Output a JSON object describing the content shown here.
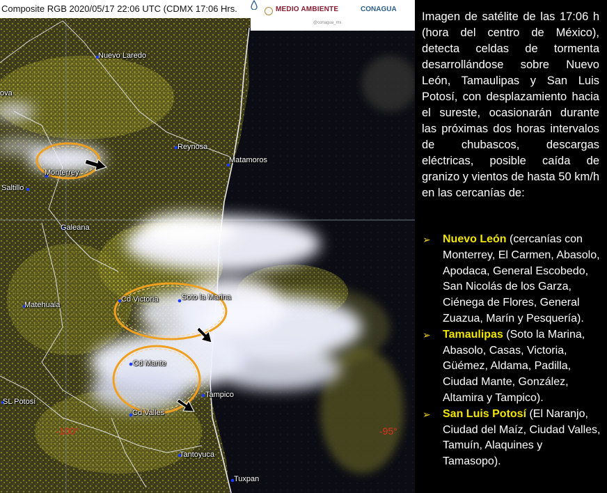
{
  "header": {
    "title": "Composite RGB 2020/05/17 22:06 UTC (CDMX  17:06 Hrs.",
    "logo_left": "MEDIO AMBIENTE",
    "logo_right": "CONAGUA",
    "logo_sub": "@conagua_mx"
  },
  "map": {
    "cities": [
      "Nuevo Laredo",
      "Reynosa",
      "Matamoros",
      "Monterrey",
      "Saltillo",
      "Galeana",
      "Cd Victoria",
      "Soto la Marina",
      "Matehuala",
      "Cd Mante",
      "Tampico",
      "SL Potosí",
      "Cd Valles",
      "Tantoyuca",
      "Tuxpan",
      "ova"
    ],
    "lon_left": "-100°",
    "lon_right": "-95°"
  },
  "panel": {
    "intro": "Imagen de satélite de las 17:06 h (hora del centro de México), detecta celdas de tormenta desarrollándose sobre Nuevo León, Tamaulipas y San Luis Potosí, con desplazamiento hacia el sureste, ocasionarán durante las próximas dos horas intervalos de chubascos, descargas eléctricas, posible caída de granizo y vientos de hasta 50 km/h en las cercanías de:",
    "bullet": "➢",
    "states": [
      {
        "name": "Nuevo León",
        "places": " (cercanías con Monterrey, El Carmen, Abasolo, Apodaca, General Escobedo, San Nicolás de los Garza, Ciénega de Flores, General Zuazua, Marín y Pesquería)."
      },
      {
        "name": "Tamaulipas",
        "places": " (Soto la Marina, Abasolo, Casas, Victoria, Güémez, Aldama, Padilla, Ciudad Mante, González, Altamira y Tampico)."
      },
      {
        "name": "San Luis Potosí",
        "places": " (El Naranjo, Ciudad del Maíz, Ciudad Valles, Tamuín, Alaquines y Tamasopo)."
      }
    ]
  },
  "colors": {
    "state_name": "#f2e600",
    "bullet": "#f2d21a",
    "ellipse": "#f0a020",
    "longitude": "#e03020"
  }
}
